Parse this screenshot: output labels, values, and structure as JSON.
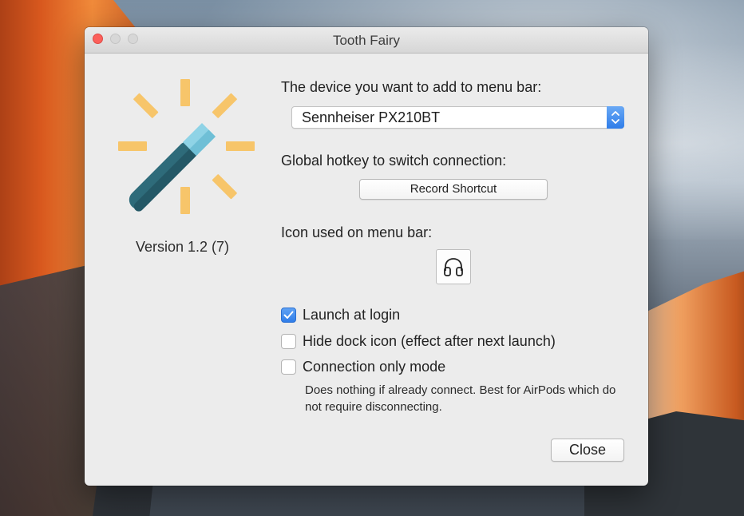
{
  "window": {
    "title": "Tooth Fairy"
  },
  "about": {
    "version": "Version 1.2 (7)"
  },
  "device": {
    "label": "The device you want to add to menu bar:",
    "selected": "Sennheiser PX210BT"
  },
  "hotkey": {
    "label": "Global hotkey to switch connection:",
    "button": "Record Shortcut"
  },
  "menubar_icon": {
    "label": "Icon used on menu bar:",
    "icon": "headphones-icon"
  },
  "options": {
    "launch_at_login": {
      "label": "Launch at login",
      "checked": true
    },
    "hide_dock_icon": {
      "label": "Hide dock icon (effect after next launch)",
      "checked": false
    },
    "connection_only": {
      "label": "Connection only mode",
      "checked": false
    },
    "connection_only_note": "Does nothing if already connect. Best for AirPods which do not require disconnecting."
  },
  "actions": {
    "close": "Close"
  },
  "colors": {
    "accent": "#2f7de9",
    "close_red": "#fc605b",
    "wand_body": "#2e6b7a",
    "wand_tip": "#8fd3e6",
    "sparkle": "#f7c56a"
  }
}
